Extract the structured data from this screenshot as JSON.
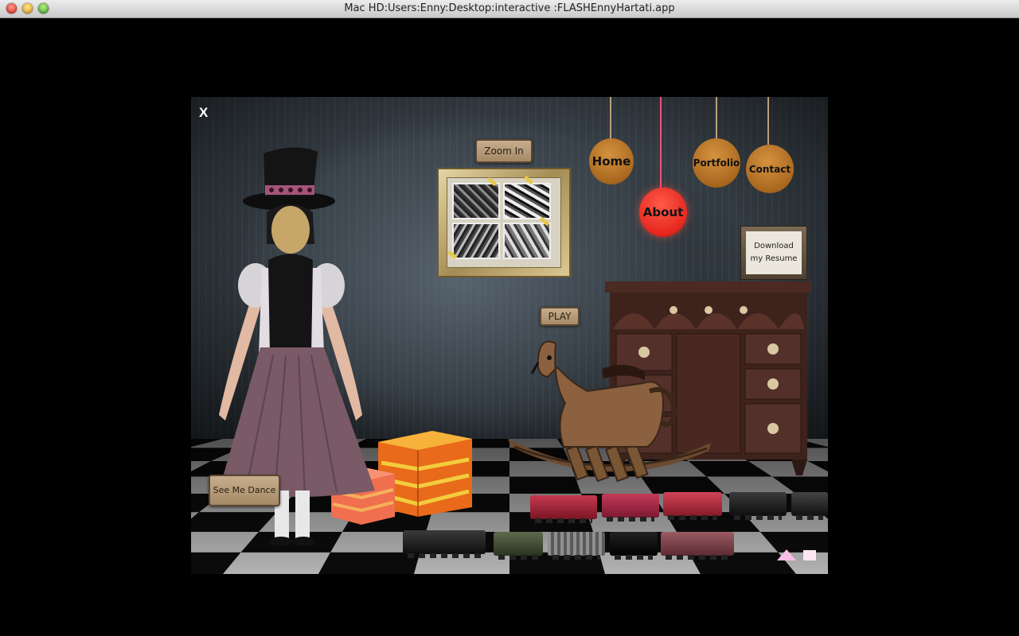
{
  "window": {
    "title": "Mac HD:Users:Enny:Desktop:interactive :FLASHEnnyHartati.app"
  },
  "stage": {
    "close_label": "X",
    "zoom_label": "Zoom In",
    "play_label": "PLAY",
    "dance_label": "See Me Dance",
    "resume_line1": "Download",
    "resume_line2": "my Resume"
  },
  "nav": {
    "home": "Home",
    "about": "About",
    "portfolio": "Portfolio",
    "contact": "Contact",
    "active": "About"
  },
  "colors": {
    "ball": "#a9681f",
    "ball_active": "#e5271e",
    "nav_triangle": "#f6bde6",
    "nav_square": "#fbe6f4"
  },
  "icons": {
    "back": "triangle-icon",
    "stop": "square-icon"
  }
}
